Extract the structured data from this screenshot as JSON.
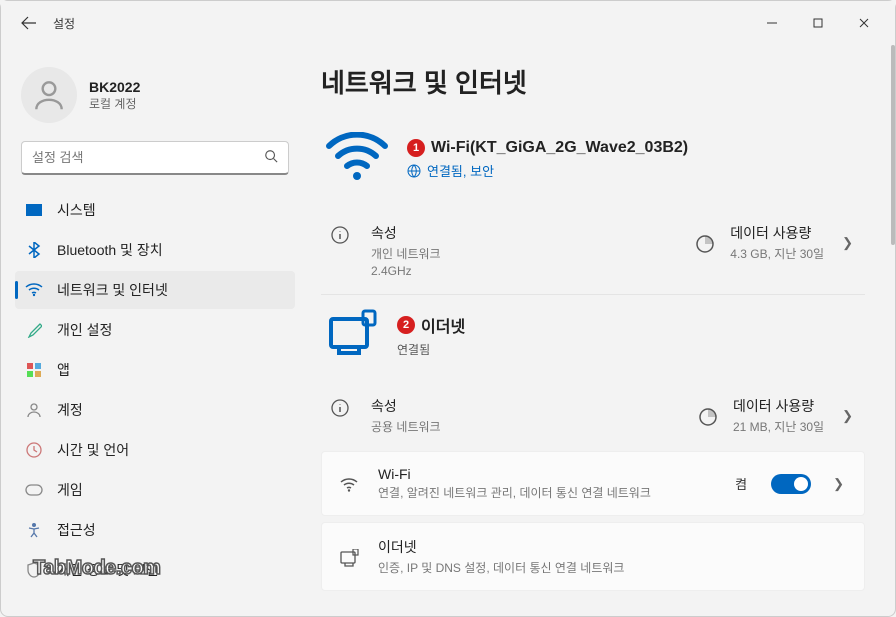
{
  "app_title": "설정",
  "user": {
    "name": "BK2022",
    "subtitle": "로컬 계정"
  },
  "search": {
    "placeholder": "설정 검색"
  },
  "nav": [
    {
      "id": "system",
      "label": "시스템",
      "icon": "🖥️",
      "selected": false
    },
    {
      "id": "bluetooth",
      "label": "Bluetooth 및 장치",
      "icon": "bt",
      "selected": false
    },
    {
      "id": "network",
      "label": "네트워크 및 인터넷",
      "icon": "wifi",
      "selected": true
    },
    {
      "id": "personalization",
      "label": "개인 설정",
      "icon": "brush",
      "selected": false
    },
    {
      "id": "apps",
      "label": "앱",
      "icon": "apps",
      "selected": false
    },
    {
      "id": "accounts",
      "label": "계정",
      "icon": "person",
      "selected": false
    },
    {
      "id": "time",
      "label": "시간 및 언어",
      "icon": "clock",
      "selected": false
    },
    {
      "id": "gaming",
      "label": "게임",
      "icon": "game",
      "selected": false
    },
    {
      "id": "accessibility",
      "label": "접근성",
      "icon": "access",
      "selected": false
    },
    {
      "id": "privacy",
      "label": "개인 정보 및 보안",
      "icon": "shield",
      "selected": false
    }
  ],
  "page": {
    "title": "네트워크 및 인터넷",
    "wifi": {
      "annotation": "1",
      "name": "Wi-Fi(KT_GiGA_2G_Wave2_03B2)",
      "status": "연결됨, 보안",
      "props_label": "속성",
      "props_sub1": "개인 네트워크",
      "props_sub2": "2.4GHz",
      "usage_label": "데이터 사용량",
      "usage_sub": "4.3 GB, 지난 30일"
    },
    "ethernet": {
      "annotation": "2",
      "name": "이더넷",
      "status": "연결됨",
      "props_label": "속성",
      "props_sub": "공용 네트워크",
      "usage_label": "데이터 사용량",
      "usage_sub": "21 MB, 지난 30일"
    },
    "cards": {
      "wifi": {
        "title": "Wi-Fi",
        "sub": "연결, 알려진 네트워크 관리, 데이터 통신 연결 네트워크",
        "toggle_label": "켬",
        "toggle_on": true
      },
      "eth": {
        "title": "이더넷",
        "sub": "인증, IP 및 DNS 설정, 데이터 통신 연결 네트워크"
      }
    }
  },
  "watermark": "TabMode.com"
}
